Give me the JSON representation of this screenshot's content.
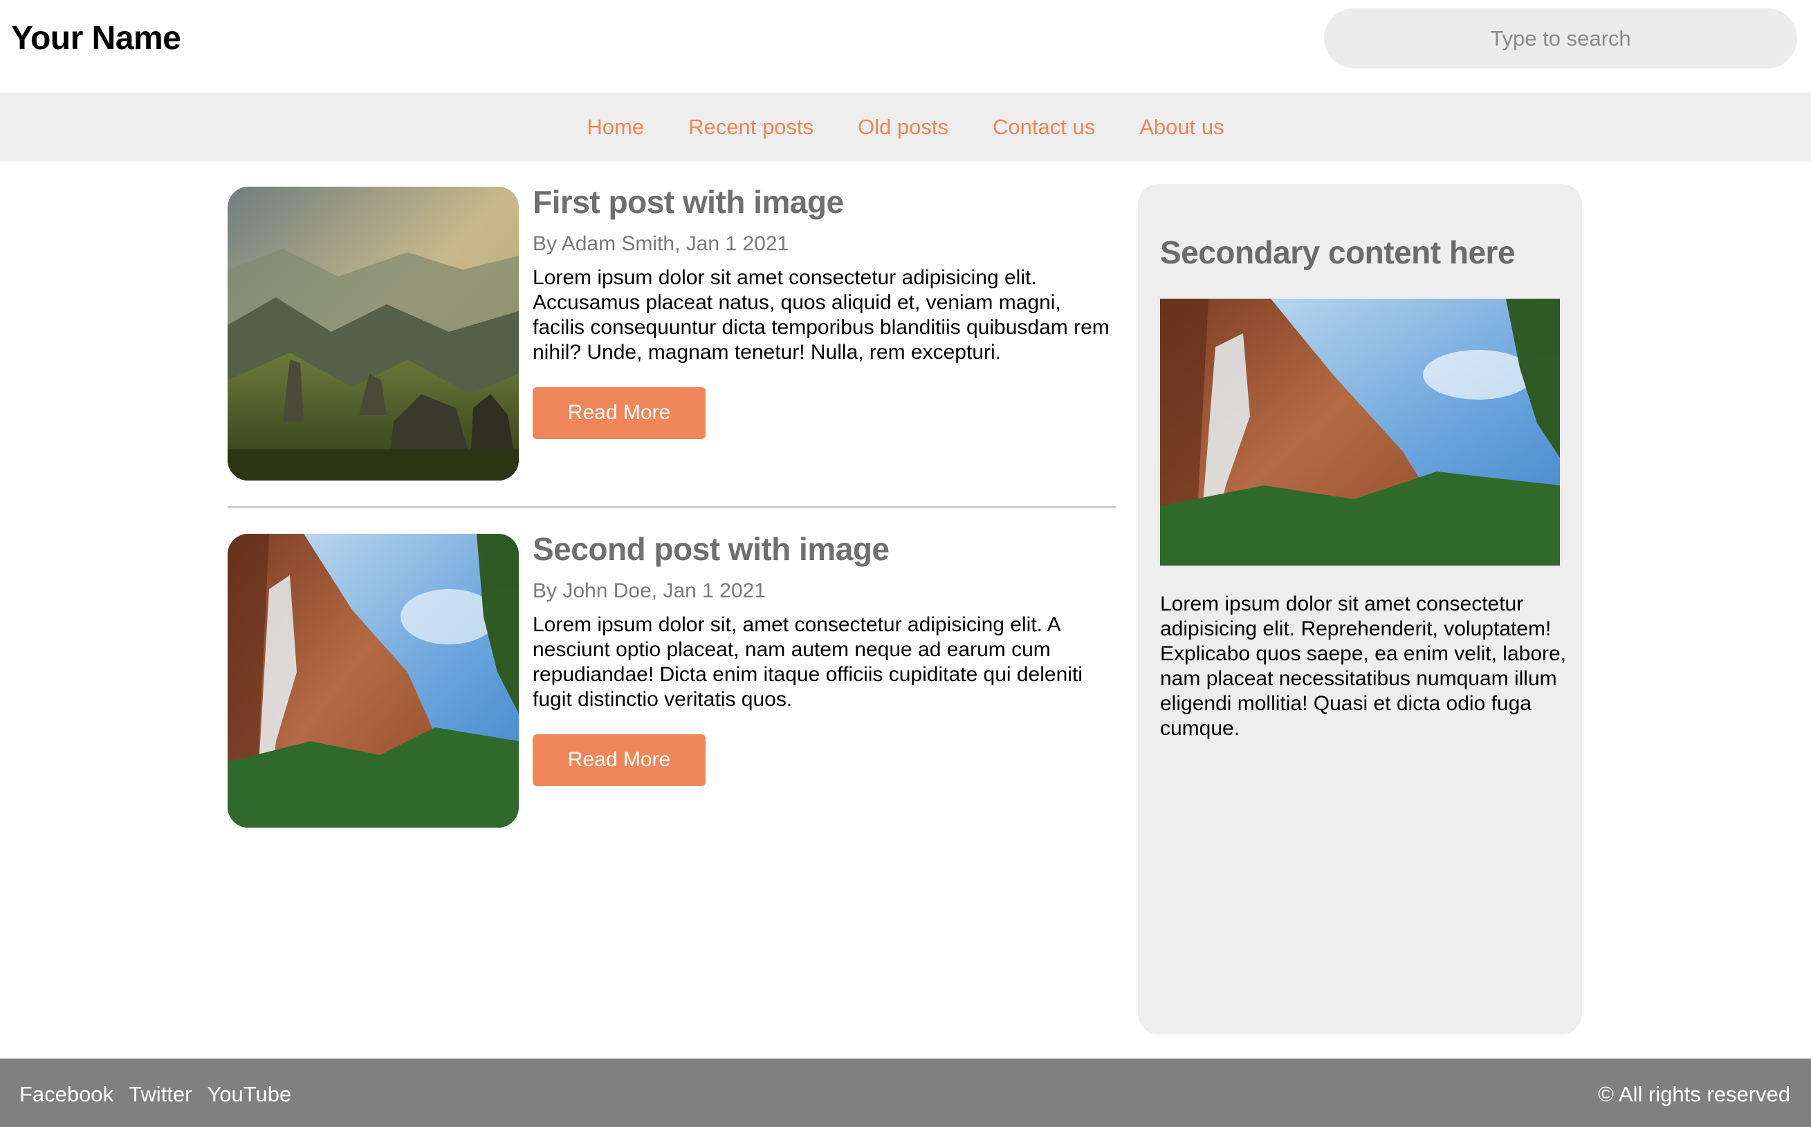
{
  "header": {
    "brand": "Your Name",
    "search_placeholder": "Type to search"
  },
  "nav": {
    "items": [
      "Home",
      "Recent posts",
      "Old posts",
      "Contact us",
      "About us"
    ]
  },
  "posts": [
    {
      "title": "First post with image",
      "byline": "By Adam Smith, Jan 1 2021",
      "body": "Lorem ipsum dolor sit amet consectetur adipisicing elit. Accusamus placeat natus, quos aliquid et, veniam magni, facilis consequuntur dicta temporibus blanditiis quibusdam rem nihil? Unde, magnam tenetur! Nulla, rem excepturi.",
      "button": "Read More",
      "image": "mountain-landscape-photo"
    },
    {
      "title": "Second post with image",
      "byline": "By John Doe, Jan 1 2021",
      "body": "Lorem ipsum dolor sit, amet consectetur adipisicing elit. A nesciunt optio placeat, nam autem neque ad earum cum repudiandae! Dicta enim itaque officiis cupiditate qui deleniti fugit distinctio veritatis quos.",
      "button": "Read More",
      "image": "canyon-waterfall-photo"
    }
  ],
  "sidebar": {
    "title": "Secondary content here",
    "image": "canyon-waterfall-photo",
    "body": "Lorem ipsum dolor sit amet consectetur adipisicing elit. Reprehenderit, voluptatem! Explicabo quos saepe, ea enim velit, labore, nam placeat necessitatibus numquam illum eligendi mollitia! Quasi et dicta odio fuga cumque."
  },
  "footer": {
    "social": [
      "Facebook",
      "Twitter",
      "YouTube"
    ],
    "copyright": "© All rights reserved"
  },
  "colors": {
    "accent": "#f0875a",
    "nav_bg": "#eeeeee",
    "footer_bg": "#808080",
    "heading_gray": "#6f6f6f"
  }
}
